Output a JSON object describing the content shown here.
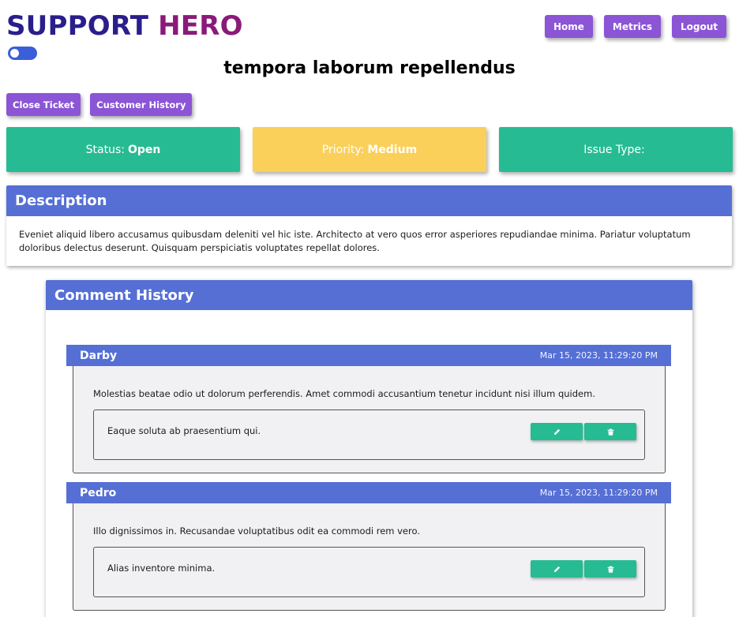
{
  "brand": {
    "word1": "SUPPORT",
    "word2": "HERO"
  },
  "nav": {
    "home": "Home",
    "metrics": "Metrics",
    "logout": "Logout"
  },
  "ticket": {
    "title": "tempora laborum repellendus",
    "actions": {
      "close": "Close Ticket",
      "history": "Customer History"
    },
    "status": {
      "label": "Status:",
      "value": "Open"
    },
    "priority": {
      "label": "Priority:",
      "value": "Medium"
    },
    "issue_type": {
      "label": "Issue Type:",
      "value": ""
    }
  },
  "description": {
    "heading": "Description",
    "text": "Eveniet aliquid libero accusamus quibusdam deleniti vel hic iste. Architecto at vero quos error asperiores repudiandae minima. Pariatur voluptatum doloribus delectus deserunt. Quisquam perspiciatis voluptates repellat dolores."
  },
  "comments": {
    "heading": "Comment History",
    "items": [
      {
        "author": "Darby",
        "time": "Mar 15, 2023, 11:29:20 PM",
        "text": "Molestias beatae odio ut dolorum perferendis. Amet commodi accusantium tenetur incidunt nisi illum quidem.",
        "reply": "Eaque soluta ab praesentium qui."
      },
      {
        "author": "Pedro",
        "time": "Mar 15, 2023, 11:29:20 PM",
        "text": "Illo dignissimos in. Recusandae voluptatibus odit ea commodi rem vero.",
        "reply": "Alias inventore minima."
      }
    ]
  },
  "icons": {
    "edit": "pencil-icon",
    "delete": "trash-icon"
  },
  "colors": {
    "accent_purple": "#8b55d6",
    "panel_blue": "#556fd5",
    "green": "#27bb93",
    "yellow": "#fad05a"
  }
}
